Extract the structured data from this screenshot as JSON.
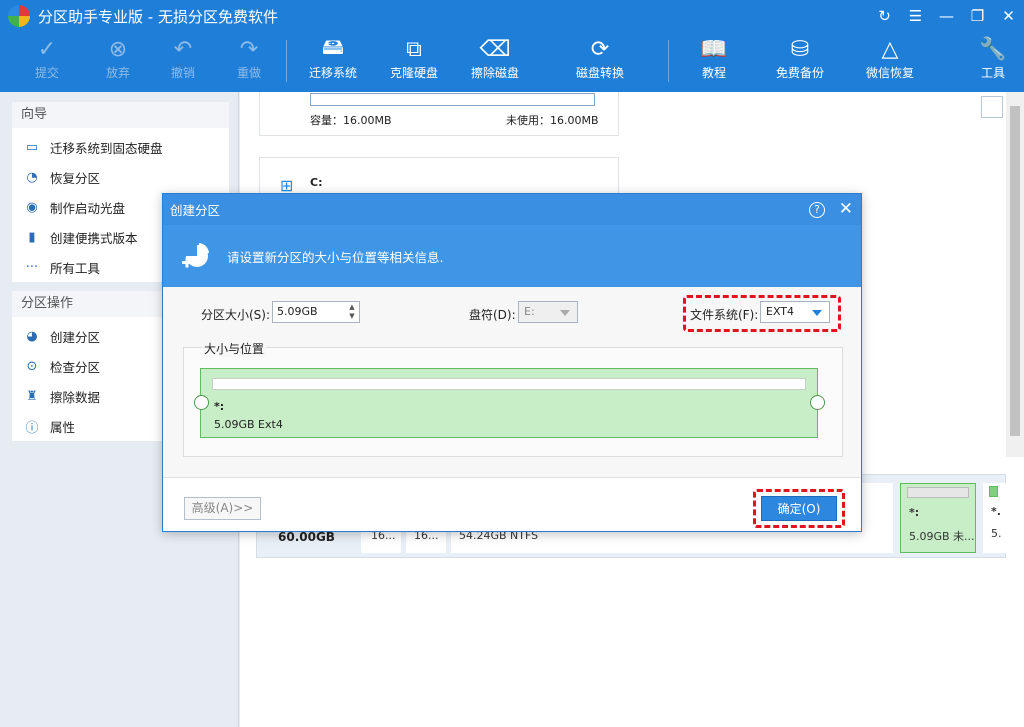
{
  "window": {
    "title": "分区助手专业版 - 无损分区免费软件",
    "controls": [
      "↻",
      "☰",
      "—",
      "❐",
      "✕"
    ]
  },
  "toolbar": {
    "items": [
      {
        "label": "提交",
        "icon": "check-icon",
        "enabled": false
      },
      {
        "label": "放弃",
        "icon": "discard-icon",
        "enabled": false
      },
      {
        "label": "撤销",
        "icon": "undo-icon",
        "enabled": false
      },
      {
        "label": "重做",
        "icon": "redo-icon",
        "enabled": false
      },
      {
        "label": "迁移系统",
        "icon": "migrate-os-icon",
        "enabled": true
      },
      {
        "label": "克隆硬盘",
        "icon": "clone-disk-icon",
        "enabled": true
      },
      {
        "label": "擦除磁盘",
        "icon": "wipe-disk-icon",
        "enabled": true
      },
      {
        "label": "磁盘转换",
        "icon": "disk-convert-icon",
        "enabled": true
      },
      {
        "label": "教程",
        "icon": "book-icon",
        "enabled": true
      },
      {
        "label": "免费备份",
        "icon": "backup-icon",
        "enabled": true
      },
      {
        "label": "微信恢复",
        "icon": "recovery-icon",
        "enabled": true
      },
      {
        "label": "工具",
        "icon": "tools-icon",
        "enabled": true
      }
    ]
  },
  "sidebar": {
    "wizard_title": "向导",
    "wizard_items": [
      {
        "label": "迁移系统到固态硬盘",
        "icon": "migrate-icon"
      },
      {
        "label": "恢复分区",
        "icon": "recover-partition-icon"
      },
      {
        "label": "制作启动光盘",
        "icon": "boot-disc-icon"
      },
      {
        "label": "创建便携式版本",
        "icon": "portable-icon"
      },
      {
        "label": "所有工具",
        "icon": "more-icon"
      }
    ],
    "ops_title": "分区操作",
    "ops_items": [
      {
        "label": "创建分区",
        "icon": "create-partition-icon"
      },
      {
        "label": "检查分区",
        "icon": "check-partition-icon"
      },
      {
        "label": "擦除数据",
        "icon": "wipe-data-icon"
      },
      {
        "label": "属性",
        "icon": "info-icon"
      }
    ]
  },
  "background": {
    "card1": {
      "capacity": "容量：16.00MB",
      "unused": "未使用：16.00MB"
    },
    "card2": {
      "label": "C:"
    },
    "disk": {
      "size": "60.00GB",
      "b1": "16...",
      "b2": "16...",
      "b3": "54.24GB NTFS",
      "b4_label": "*:",
      "b4_size": "5.09GB 未...",
      "b5_label": "*.",
      "b5_size": "5."
    }
  },
  "dialog": {
    "title": "创建分区",
    "banner_text": "请设置新分区的大小与位置等相关信息.",
    "size_label": "分区大小(S):",
    "size_value": "5.09GB",
    "drive_label": "盘符(D):",
    "drive_value": "E:",
    "fs_label": "文件系统(F):",
    "fs_value": "EXT4",
    "group_title": "大小与位置",
    "part_label": "*:",
    "part_size": "5.09GB Ext4",
    "advanced_label": "高级(A)>>",
    "ok_label": "确定(O)"
  },
  "colors": {
    "accent": "#1f7fd8",
    "highlight": "#e0141f",
    "partition_green": "#c8eec8"
  }
}
